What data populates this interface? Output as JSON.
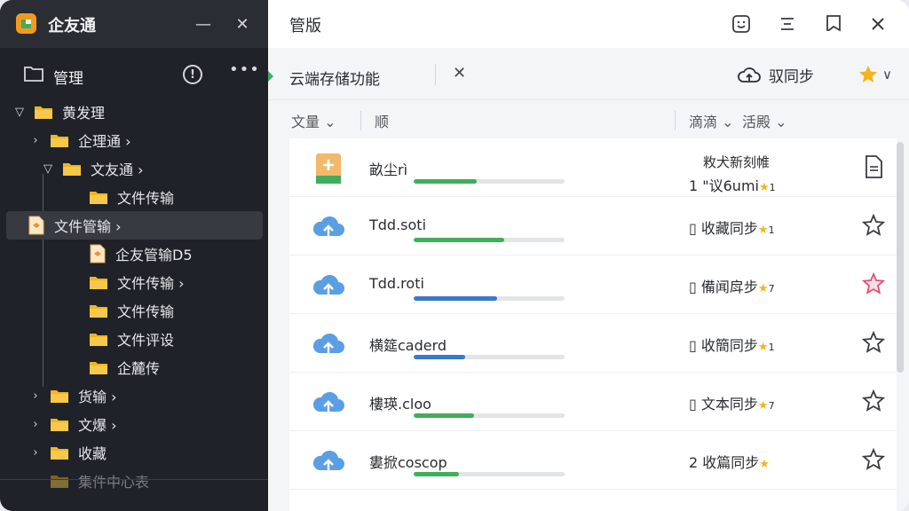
{
  "sidebar": {
    "app_name": "企友通",
    "header_title": "管理",
    "tree": [
      {
        "label": "黄发理",
        "arrow": "▽",
        "indent": 0,
        "kind": "folder"
      },
      {
        "label": "企理通 ›",
        "arrow": "›",
        "indent": 1,
        "kind": "folder"
      },
      {
        "label": "文友通 ›",
        "arrow": "▽",
        "indent": 2,
        "kind": "folder"
      },
      {
        "label": "文件传输",
        "arrow": "",
        "indent": 3,
        "kind": "folder"
      },
      {
        "label": "文件管输 ›",
        "arrow": "",
        "indent": 3,
        "kind": "file",
        "selected": true
      },
      {
        "label": "企友管输D5",
        "arrow": "",
        "indent": 3,
        "kind": "file"
      },
      {
        "label": "文件传输 ›",
        "arrow": "",
        "indent": 3,
        "kind": "folder"
      },
      {
        "label": "文件传输",
        "arrow": "",
        "indent": 3,
        "kind": "folder"
      },
      {
        "label": "文件评设",
        "arrow": "",
        "indent": 3,
        "kind": "folder"
      },
      {
        "label": "企麓传",
        "arrow": "",
        "indent": 3,
        "kind": "folder"
      },
      {
        "label": "货输 ›",
        "arrow": "›",
        "indent": 1,
        "kind": "folder"
      },
      {
        "label": "文爆 ›",
        "arrow": "›",
        "indent": 1,
        "kind": "folder"
      },
      {
        "label": "收藏",
        "arrow": "›",
        "indent": 1,
        "kind": "folder"
      },
      {
        "label": "集件中心表",
        "arrow": "",
        "indent": 1,
        "kind": "folder",
        "faded": true
      }
    ]
  },
  "main": {
    "title": "管版",
    "tab_label": "云端存储功能",
    "sync_label": "驭同步",
    "star_menu_caret": "∨",
    "columns": {
      "name": "文量 ⌄",
      "type": "顺",
      "sort": "滴滴 ⌄",
      "filter": "活殿 ⌄"
    },
    "rows": [
      {
        "name": "畝尘rì",
        "icon": "file-add-icon",
        "progress": 0.42,
        "bar_color": "#3fae5a",
        "status": "1 \"议6umi",
        "status_extra": "敉犬新刻帷",
        "star_suffix": "1",
        "action": "document-icon"
      },
      {
        "name": "Tdd.soti",
        "icon": "cloud-upload-icon",
        "progress": 0.6,
        "bar_color": "#3fae5a",
        "status": "▯ 收藏同步",
        "star_suffix": "1",
        "action": "star-outline-icon"
      },
      {
        "name": "Tdd.roti",
        "icon": "cloud-upload-icon",
        "progress": 0.55,
        "bar_color": "#3b78c9",
        "status": "▯ 備闻戽步",
        "star_suffix": "7",
        "action": "star-pink-icon"
      },
      {
        "name": "横筵caderd",
        "icon": "cloud-upload-icon",
        "progress": 0.34,
        "bar_color": "#3b78c9",
        "status": "▯ 收簡同步",
        "star_suffix": "1",
        "action": "star-outline-icon"
      },
      {
        "name": "樓瑛.cloo",
        "icon": "cloud-upload-icon",
        "progress": 0.4,
        "bar_color": "#3fae5a",
        "status": "▯ 文本同步",
        "star_suffix": "7",
        "action": "star-outline-icon"
      },
      {
        "name": "婁掀coscop",
        "icon": "cloud-upload-icon",
        "progress": 0.3,
        "bar_color": "#3fae5a",
        "status": "2 收篇同步",
        "star_suffix": "",
        "action": "star-outline-icon"
      }
    ]
  },
  "colors": {
    "accent_green": "#3fae5a",
    "accent_blue": "#3b78c9",
    "star_gold": "#f2b51a",
    "star_pink": "#e0507a",
    "sidebar_bg": "#1f2229"
  }
}
